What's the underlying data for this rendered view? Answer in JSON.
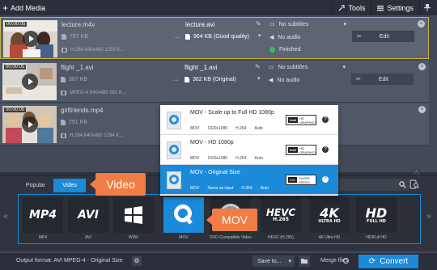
{
  "topbar": {
    "add_media_label": "Add Media",
    "tools_label": "Tools",
    "settings_label": "Settings"
  },
  "files": [
    {
      "duration": "00:00:05",
      "name": "lecture.m4v",
      "size": "767 KB",
      "meta": "H.264 640x480 1253 K...",
      "output_name": "lecture.avi",
      "output_size": "964 KB (Good quality)",
      "subtitles": "No subtitles",
      "audio": "No audio",
      "status": "Finished",
      "edit_label": "Edit"
    },
    {
      "duration": "00:00:05",
      "name": "flight _1.avi",
      "size": "367 KB",
      "meta": "MPEG-4 640x480 581 K...",
      "output_name": "flight _1.avi",
      "output_size": "362 KB (Original)",
      "subtitles": "No subtitles",
      "audio": "No audio",
      "status": "",
      "edit_label": "Edit"
    },
    {
      "duration": "00:00:05",
      "name": "girlfriends.mp4",
      "size": "791 KB",
      "meta": "H.264 640x480 1294 K...",
      "output_name": "",
      "output_size": "",
      "subtitles": "",
      "audio": "",
      "status": "",
      "edit_label": ""
    }
  ],
  "presets": [
    {
      "title": "MOV - Scale up to Full HD 1080p",
      "codec": "MOV",
      "res": "1920x1080",
      "vcodec": "H.264",
      "audio": "Auto",
      "badge_brand": "Intel",
      "badge_text": "HD GRAPHICS"
    },
    {
      "title": "MOV - HD 1080p",
      "codec": "MOV",
      "res": "1920x1080",
      "vcodec": "H.264",
      "audio": "Auto",
      "badge_brand": "Intel",
      "badge_text": "HD GRAPHICS"
    },
    {
      "title": "MOV - Original Size",
      "codec": "MOV",
      "res": "Same as input",
      "vcodec": "H.264",
      "audio": "Auto",
      "badge_brand": ">>>",
      "badge_text": "SUPER SPEED"
    }
  ],
  "tabs": {
    "popular": "Popular",
    "video": "Video"
  },
  "formats": [
    {
      "big": "MP4",
      "small": "",
      "label": "MP4"
    },
    {
      "big": "AVI",
      "small": "",
      "label": "AVI"
    },
    {
      "big": "",
      "small": "",
      "label": "WMV"
    },
    {
      "big": "",
      "small": "",
      "label": "MOV"
    },
    {
      "big": "",
      "small": "",
      "label": "DVD-Compatible Video"
    },
    {
      "big": "HEVC",
      "small": "H.265",
      "label": "HEVC (H.265)"
    },
    {
      "big": "4K",
      "small": "ULTRA HD",
      "label": "4K Ultra HD"
    },
    {
      "big": "HD",
      "small": "FULL HD",
      "label": "HD/Full HD"
    }
  ],
  "callouts": {
    "video": "Video",
    "mov": "MOV"
  },
  "bottom": {
    "output_format": "Output format: AVI MPEG-4 - Original Size",
    "save_to": "Save to...",
    "merge_files": "Merge files",
    "convert": "Convert"
  },
  "colors": {
    "accent": "#1a8ad9",
    "callout": "#ef7d45",
    "finished_dot": "#3fb86a",
    "selected_border": "#c8b53f"
  }
}
